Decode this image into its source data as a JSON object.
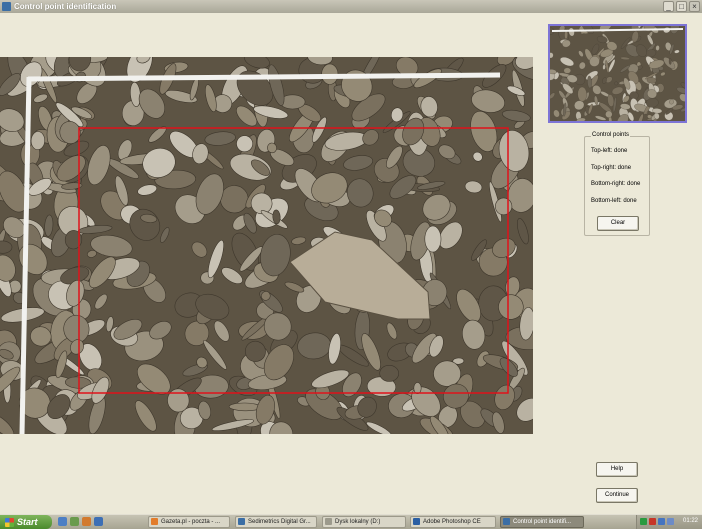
{
  "window": {
    "title": "Control point identification",
    "minimize_glyph": "_",
    "maximize_glyph": "□",
    "close_glyph": "×"
  },
  "photo": {
    "description_icon": "sediment-photo"
  },
  "control_points": {
    "legend": "Control points",
    "top_left": "Top-left: done",
    "top_right": "Top-right: done",
    "bottom_right": "Bottom-right: done",
    "bottom_left": "Bottom-left: done",
    "clear_label": "Clear"
  },
  "buttons": {
    "help_label": "Help",
    "continue_label": "Continue"
  },
  "taskbar": {
    "start_label": "Start",
    "tasks": [
      "Gazeta.pl - poczta - ...",
      "Sedimetrics Digital Gr...",
      "Dysk lokalny (D:)",
      "Adobe Photoshop CE",
      "Control point identifi..."
    ],
    "clock": "01:22"
  },
  "colors": {
    "selection": "#e0121a",
    "thumb_border": "#7d74d6",
    "taskbar": "#b0ad9c"
  }
}
